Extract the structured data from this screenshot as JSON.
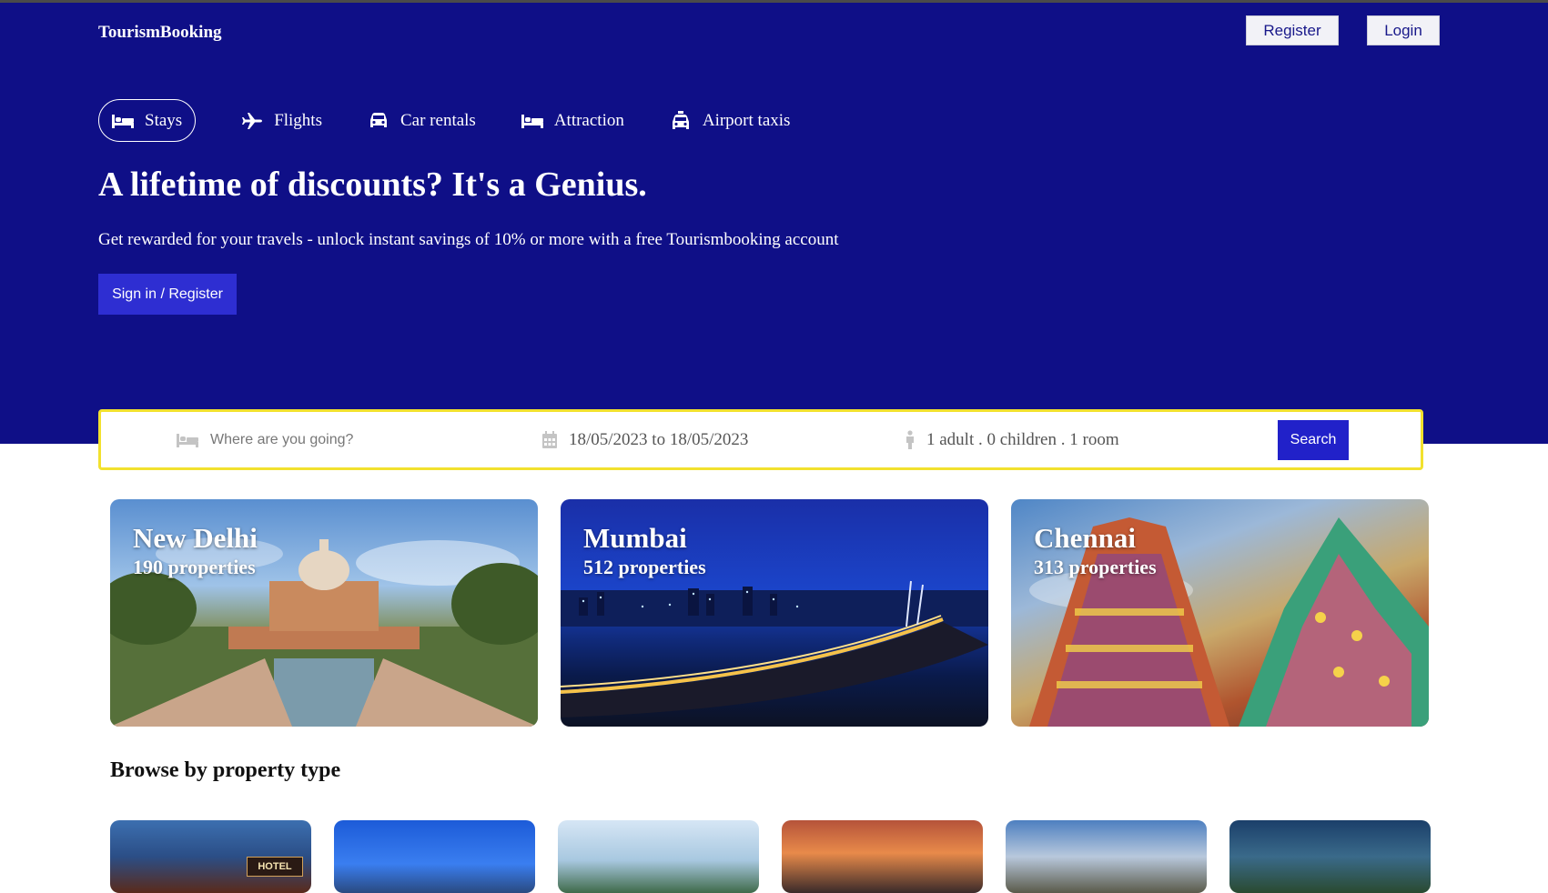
{
  "colors": {
    "brand": "#0f0f87",
    "accent_button": "#2121c9",
    "search_border": "#f2e12e"
  },
  "header": {
    "logo": "TourismBooking",
    "register_label": "Register",
    "login_label": "Login"
  },
  "tabs": [
    {
      "label": "Stays",
      "icon": "bed-icon",
      "active": true
    },
    {
      "label": "Flights",
      "icon": "plane-icon",
      "active": false
    },
    {
      "label": "Car rentals",
      "icon": "car-icon",
      "active": false
    },
    {
      "label": "Attraction",
      "icon": "bed-icon",
      "active": false
    },
    {
      "label": "Airport taxis",
      "icon": "taxi-icon",
      "active": false
    }
  ],
  "hero": {
    "title": "A lifetime of discounts? It's a Genius.",
    "description": "Get rewarded for your travels - unlock instant savings of 10% or more with a free Tourismbooking account",
    "signin_label": "Sign in / Register"
  },
  "search": {
    "destination_placeholder": "Where are you going?",
    "dates": "18/05/2023 to 18/05/2023",
    "guests": "1 adult . 0 children . 1 room",
    "button_label": "Search"
  },
  "cities": [
    {
      "name": "New Delhi",
      "properties": "190 properties"
    },
    {
      "name": "Mumbai",
      "properties": "512 properties"
    },
    {
      "name": "Chennai",
      "properties": "313 properties"
    }
  ],
  "browse": {
    "title": "Browse by property type",
    "hotel_sign": "HOTEL"
  }
}
